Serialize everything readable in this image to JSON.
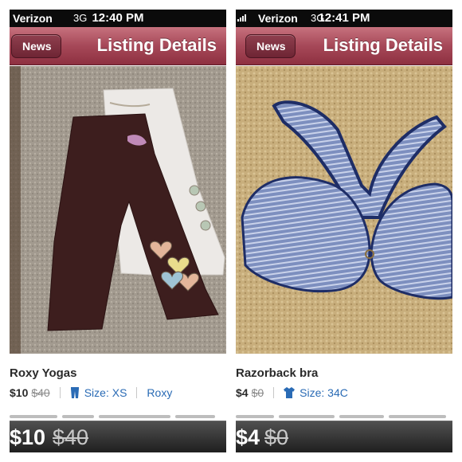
{
  "panels": [
    {
      "status": {
        "carrier": "Verizon",
        "network": "3G",
        "time": "12:40 PM"
      },
      "nav": {
        "back_label": "News",
        "title": "Listing Details"
      },
      "listing": {
        "title": "Roxy Yogas",
        "price": "$10",
        "original_price": "$40",
        "size": "Size: XS",
        "brand": "Roxy",
        "size_icon": "pants-icon"
      },
      "price_bar": {
        "price": "$10",
        "original_price": "$40"
      }
    },
    {
      "status": {
        "carrier": "Verizon",
        "network": "3G",
        "time": "12:41 PM"
      },
      "nav": {
        "back_label": "News",
        "title": "Listing Details"
      },
      "listing": {
        "title": "Razorback bra",
        "price": "$4",
        "original_price": "$0",
        "size": "Size: 34C",
        "size_icon": "shirt-icon"
      },
      "price_bar": {
        "price": "$4",
        "original_price": "$0"
      }
    }
  ],
  "colors": {
    "nav_bar": "#a64858",
    "link_blue": "#2a6bb5",
    "price_bar": "#2f2f2f"
  }
}
